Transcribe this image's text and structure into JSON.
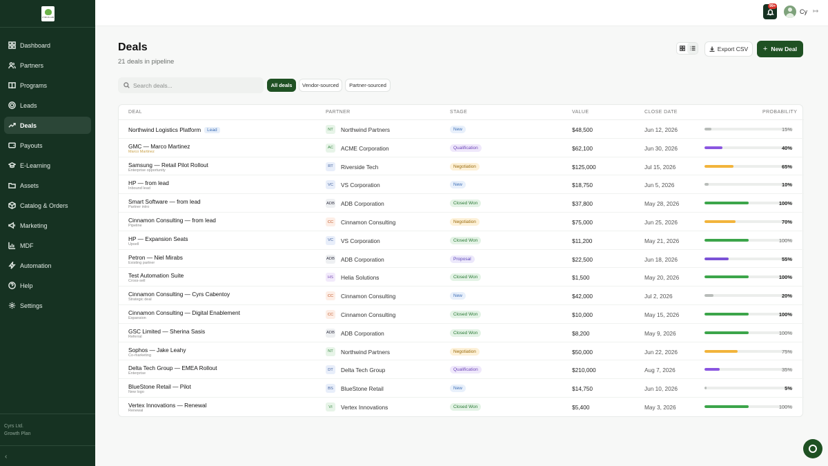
{
  "sidebar": {
    "logo_text": "CYRUS LAB",
    "items": [
      {
        "label": "Dashboard",
        "icon": "grid-icon"
      },
      {
        "label": "Partners",
        "icon": "users-icon"
      },
      {
        "label": "Programs",
        "icon": "book-icon"
      },
      {
        "label": "Leads",
        "icon": "target-icon"
      },
      {
        "label": "Deals",
        "icon": "trend-icon",
        "active": true
      },
      {
        "label": "Payouts",
        "icon": "wallet-icon"
      },
      {
        "label": "E-Learning",
        "icon": "graduation-icon"
      },
      {
        "label": "Assets",
        "icon": "folder-icon"
      },
      {
        "label": "Catalog & Orders",
        "icon": "box-icon"
      },
      {
        "label": "Marketing",
        "icon": "megaphone-icon"
      },
      {
        "label": "MDF",
        "icon": "chart-icon"
      },
      {
        "label": "Automation",
        "icon": "bolt-icon"
      },
      {
        "label": "Help",
        "icon": "help-icon"
      },
      {
        "label": "Settings",
        "icon": "gear-icon"
      }
    ],
    "footer": {
      "company": "Cyrs Ltd.",
      "plan": "Growth Plan"
    },
    "collapse_glyph": "‹"
  },
  "topbar": {
    "notification_badge": "99+",
    "user_initials": "Cy"
  },
  "header": {
    "title": "Deals",
    "subtitle": "21 deals in pipeline",
    "export_label": "Export CSV",
    "new_deal_label": "New Deal"
  },
  "filters": {
    "search_placeholder": "Search deals...",
    "chips": [
      "All deals",
      "Vendor-sourced",
      "Partner-sourced"
    ],
    "selected": "All deals"
  },
  "table": {
    "columns": {
      "deal": "DEAL",
      "partner": "PARTNER",
      "stage": "STAGE",
      "value": "VALUE",
      "close_date": "CLOSE DATE",
      "probability": "PROBABILITY"
    },
    "rows": [
      {
        "deal": "Northwind Logistics Platform",
        "sub": "",
        "tag": "Lead",
        "initials": "NT",
        "partner": "Northwind Partners",
        "stage": "New",
        "value": "$48,500",
        "date": "Jun 12, 2026",
        "prob": "15%",
        "pct": 15
      },
      {
        "deal": "GMC — Marco Martinez",
        "sub": "Marco Martinez",
        "sub_accent": true,
        "initials": "AC",
        "partner": "ACME Corporation",
        "stage": "Qualification",
        "value": "$62,100",
        "date": "Jun 30, 2026",
        "prob": "40%",
        "pct": 40
      },
      {
        "deal": "Samsung — Retail Pilot Rollout",
        "sub": "Enterprise opportunity",
        "initials": "RT",
        "partner": "Riverside Tech",
        "stage": "Negotiation",
        "value": "$125,000",
        "date": "Jul 15, 2026",
        "prob": "65%",
        "pct": 65
      },
      {
        "deal": "HP — from lead",
        "sub": "Inbound lead",
        "initials": "VC",
        "partner": "VS Corporation",
        "stage": "New",
        "value": "$18,750",
        "date": "Jun 5, 2026",
        "prob": "10%",
        "pct": 10
      },
      {
        "deal": "Smart Software — from lead",
        "sub": "Partner intro",
        "initials": "ADB",
        "partner": "ADB Corporation",
        "stage": "Closed Won",
        "value": "$37,800",
        "date": "May 28, 2026",
        "prob": "100%",
        "pct": 100
      },
      {
        "deal": "Cinnamon Consulting — from lead",
        "sub": "Pipeline",
        "initials": "CC",
        "partner": "Cinnamon Consulting",
        "stage": "Negotiation",
        "value": "$75,000",
        "date": "Jun 25, 2026",
        "prob": "70%",
        "pct": 70
      },
      {
        "deal": "HP — Expansion Seats",
        "sub": "Upsell",
        "initials": "VC",
        "partner": "VS Corporation",
        "stage": "Closed Won",
        "value": "$11,200",
        "date": "May 21, 2026",
        "prob": "100%",
        "pct": 100
      },
      {
        "deal": "Petron — Niel Mirabs",
        "sub": "Existing partner",
        "initials": "ADB",
        "partner": "ADB Corporation",
        "stage": "Proposal",
        "value": "$22,500",
        "date": "Jun 18, 2026",
        "prob": "55%",
        "pct": 55
      },
      {
        "deal": "Test Automation Suite",
        "sub": "Cross-sell",
        "initials": "HS",
        "partner": "Helia Solutions",
        "stage": "Closed Won",
        "value": "$1,500",
        "date": "May 20, 2026",
        "prob": "100%",
        "pct": 100
      },
      {
        "deal": "Cinnamon Consulting — Cyrs Cabentoy",
        "sub": "Strategic deal",
        "initials": "CC",
        "partner": "Cinnamon Consulting",
        "stage": "New",
        "value": "$42,000",
        "date": "Jul 2, 2026",
        "prob": "20%",
        "pct": 20
      },
      {
        "deal": "Cinnamon Consulting — Digital Enablement",
        "sub": "Expansion",
        "initials": "CC",
        "partner": "Cinnamon Consulting",
        "stage": "Closed Won",
        "value": "$10,000",
        "date": "May 15, 2026",
        "prob": "100%",
        "pct": 100
      },
      {
        "deal": "GSC Limited — Sherina Sasis",
        "sub": "Referral",
        "initials": "ADB",
        "partner": "ADB Corporation",
        "stage": "Closed Won",
        "value": "$8,200",
        "date": "May 9, 2026",
        "prob": "100%",
        "pct": 100
      },
      {
        "deal": "Sophos — Jake Leahy",
        "sub": "Co-marketing",
        "initials": "NT",
        "partner": "Northwind Partners",
        "stage": "Negotiation",
        "value": "$50,000",
        "date": "Jun 22, 2026",
        "prob": "75%",
        "pct": 75
      },
      {
        "deal": "Delta Tech Group — EMEA Rollout",
        "sub": "Enterprise",
        "initials": "DT",
        "partner": "Delta Tech Group",
        "stage": "Qualification",
        "value": "$210,000",
        "date": "Aug 7, 2026",
        "prob": "35%",
        "pct": 35
      },
      {
        "deal": "BlueStone Retail — Pilot",
        "sub": "New logo",
        "initials": "BS",
        "partner": "BlueStone Retail",
        "stage": "New",
        "value": "$14,750",
        "date": "Jun 10, 2026",
        "prob": "5%",
        "pct": 5
      },
      {
        "deal": "Vertex Innovations — Renewal",
        "sub": "Renewal",
        "initials": "VI",
        "partner": "Vertex Innovations",
        "stage": "Closed Won",
        "value": "$5,400",
        "date": "May 3, 2026",
        "prob": "100%",
        "pct": 100
      }
    ]
  },
  "colors": {
    "accent": "#1f5123",
    "sidebar_bg": "#163222",
    "stage": {
      "New": {
        "bg": "#e8f0fb",
        "fg": "#3e6fb6"
      },
      "Qualification": {
        "bg": "#efe8fb",
        "fg": "#6d45b8"
      },
      "Negotiation": {
        "bg": "#fdf1d8",
        "fg": "#9a6a0c"
      },
      "Closed Won": {
        "bg": "#e4f3e6",
        "fg": "#2b7a36"
      },
      "Proposal": {
        "bg": "#ece8fb",
        "fg": "#5b45b8"
      }
    },
    "bar": {
      "New": "#b8bcb9",
      "Qualification": "#8a56e0",
      "Negotiation": "#f2b43c",
      "Closed Won": "#3ca54a",
      "Proposal": "#7b52d6"
    },
    "initials": {
      "NT": {
        "bg": "#e7f4e8",
        "fg": "#3c8a46"
      },
      "AC": {
        "bg": "#e7f4e8",
        "fg": "#3c8a46"
      },
      "RT": {
        "bg": "#e8eefa",
        "fg": "#3e5f9c"
      },
      "VC": {
        "bg": "#e8eefa",
        "fg": "#3e5f9c"
      },
      "ADB": {
        "bg": "#eef0f2",
        "fg": "#334"
      },
      "CC": {
        "bg": "#fdeee6",
        "fg": "#c25a2c"
      },
      "HS": {
        "bg": "#f2eafb",
        "fg": "#7a4db5"
      },
      "DT": {
        "bg": "#e8eefa",
        "fg": "#3e5f9c"
      },
      "BS": {
        "bg": "#e8eefa",
        "fg": "#3e5f9c"
      },
      "VI": {
        "bg": "#e7f4e8",
        "fg": "#3c8a46"
      }
    }
  }
}
